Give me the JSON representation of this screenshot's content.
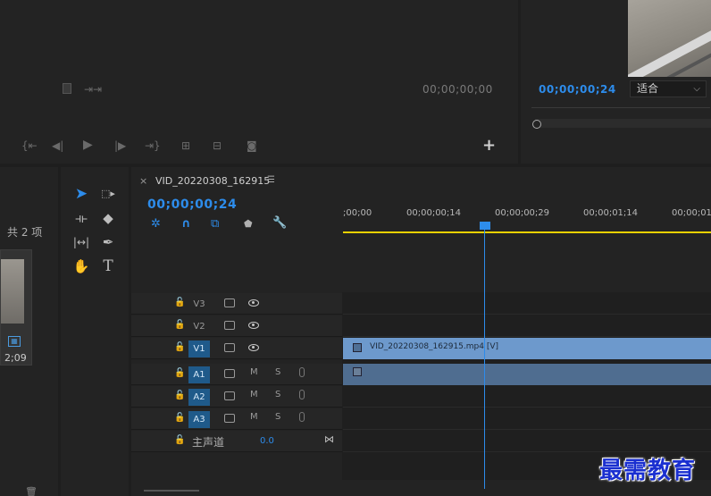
{
  "source_monitor": {
    "timecode": "00;00;00;00",
    "add_label": "+"
  },
  "program_monitor": {
    "timecode": "00;00;00;24",
    "fit_select": "适合"
  },
  "project": {
    "item_count": "，共 2 项",
    "thumb_duration": "2;09"
  },
  "timeline": {
    "close_label": "×",
    "sequence_name": "VID_20220308_162915",
    "menu_icon": "☰",
    "timecode": "00;00;00;24",
    "ruler_labels": [
      ";00;00",
      "00;00;00;14",
      "00;00;00;29",
      "00;00;01;14",
      "00;00;01;"
    ],
    "video_tracks": [
      {
        "label": "V3",
        "active": false
      },
      {
        "label": "V2",
        "active": false
      },
      {
        "label": "V1",
        "active": true
      }
    ],
    "audio_tracks": [
      {
        "label": "A1",
        "m": "M",
        "s": "S"
      },
      {
        "label": "A2",
        "m": "M",
        "s": "S"
      },
      {
        "label": "A3",
        "m": "M",
        "s": "S"
      }
    ],
    "master": {
      "label": "主声道",
      "value": "0.0"
    },
    "video_clip_name": "VID_20220308_162915.mp4 [V]"
  },
  "watermark": "最需教育",
  "colors": {
    "accent": "#2d8ceb",
    "clip_video": "#6d99cc",
    "clip_audio": "#4f6d90",
    "work_area": "#e8d100"
  }
}
